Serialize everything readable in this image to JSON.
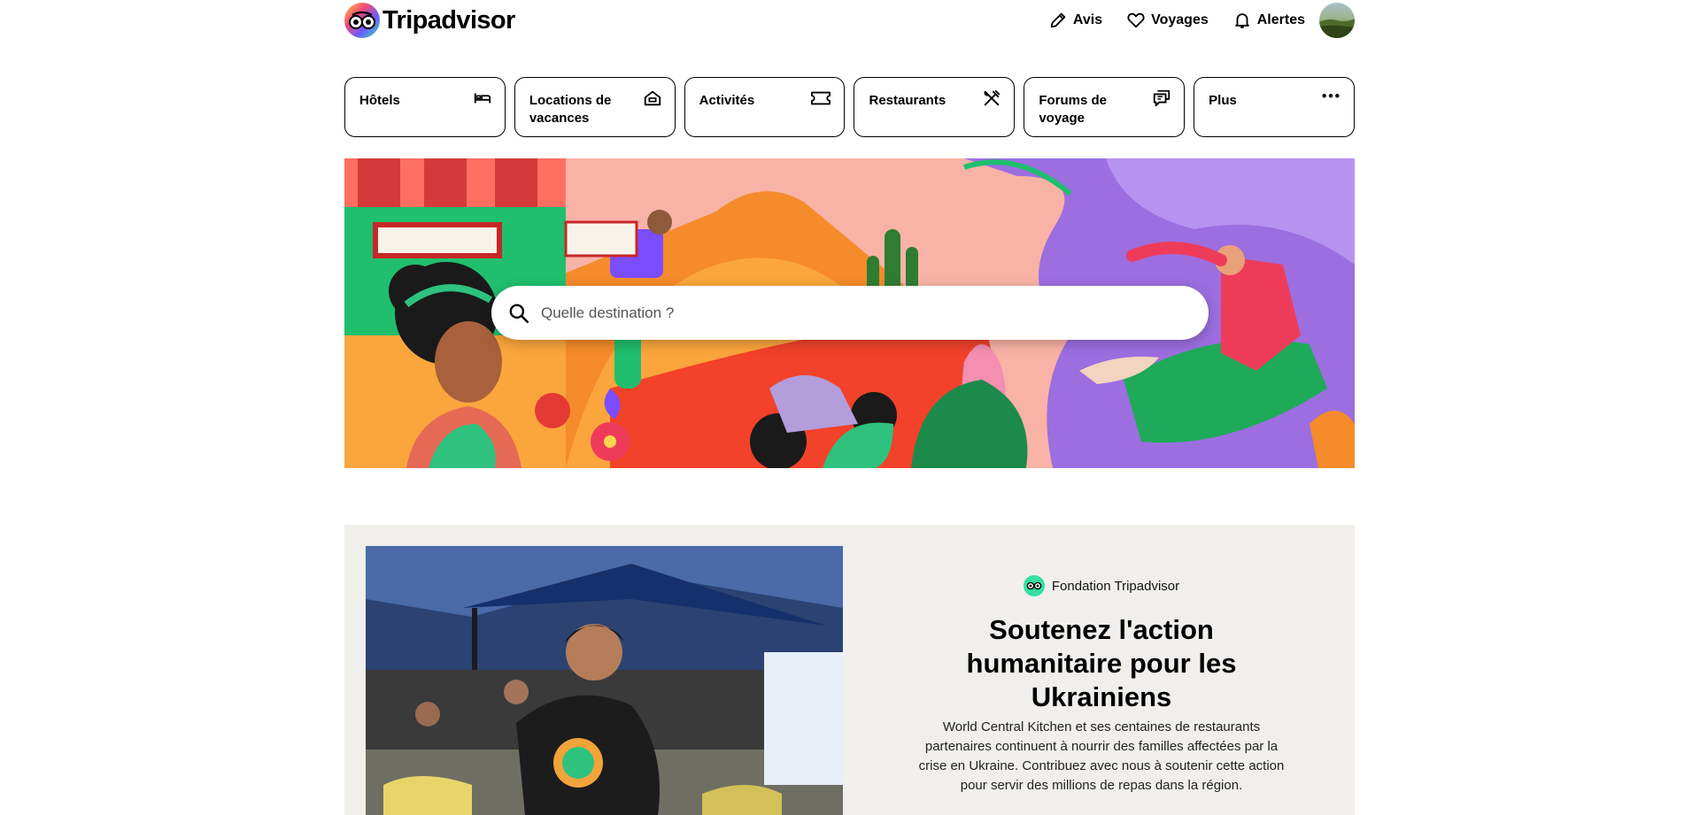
{
  "header": {
    "logo_text": "Tripadvisor",
    "nav": [
      {
        "label": "Avis",
        "icon": "pencil-icon"
      },
      {
        "label": "Voyages",
        "icon": "heart-icon"
      },
      {
        "label": "Alertes",
        "icon": "bell-icon"
      }
    ]
  },
  "categories": [
    {
      "label": "Hôtels",
      "icon": "bed-icon"
    },
    {
      "label": "Locations de vacances",
      "icon": "house-icon"
    },
    {
      "label": "Activités",
      "icon": "ticket-icon"
    },
    {
      "label": "Restaurants",
      "icon": "utensils-icon"
    },
    {
      "label": "Forums de voyage",
      "icon": "chat-bubbles-icon"
    },
    {
      "label": "Plus",
      "icon": "more-dots-icon"
    }
  ],
  "search": {
    "placeholder": "Quelle destination ?"
  },
  "foundation": {
    "badge": "Fondation Tripadvisor",
    "title": "Soutenez l'action humanitaire pour les Ukrainiens",
    "body": "World Central Kitchen et ses centaines de restaurants partenaires continuent à nourrir des familles affectées par la crise en Ukraine. Contribuez avec nous à soutenir cette action pour servir des millions de repas dans la région."
  },
  "colors": {
    "brand_green": "#34e0a1",
    "hero_background": "#f9b3a6",
    "section_background": "#f0efeb"
  }
}
